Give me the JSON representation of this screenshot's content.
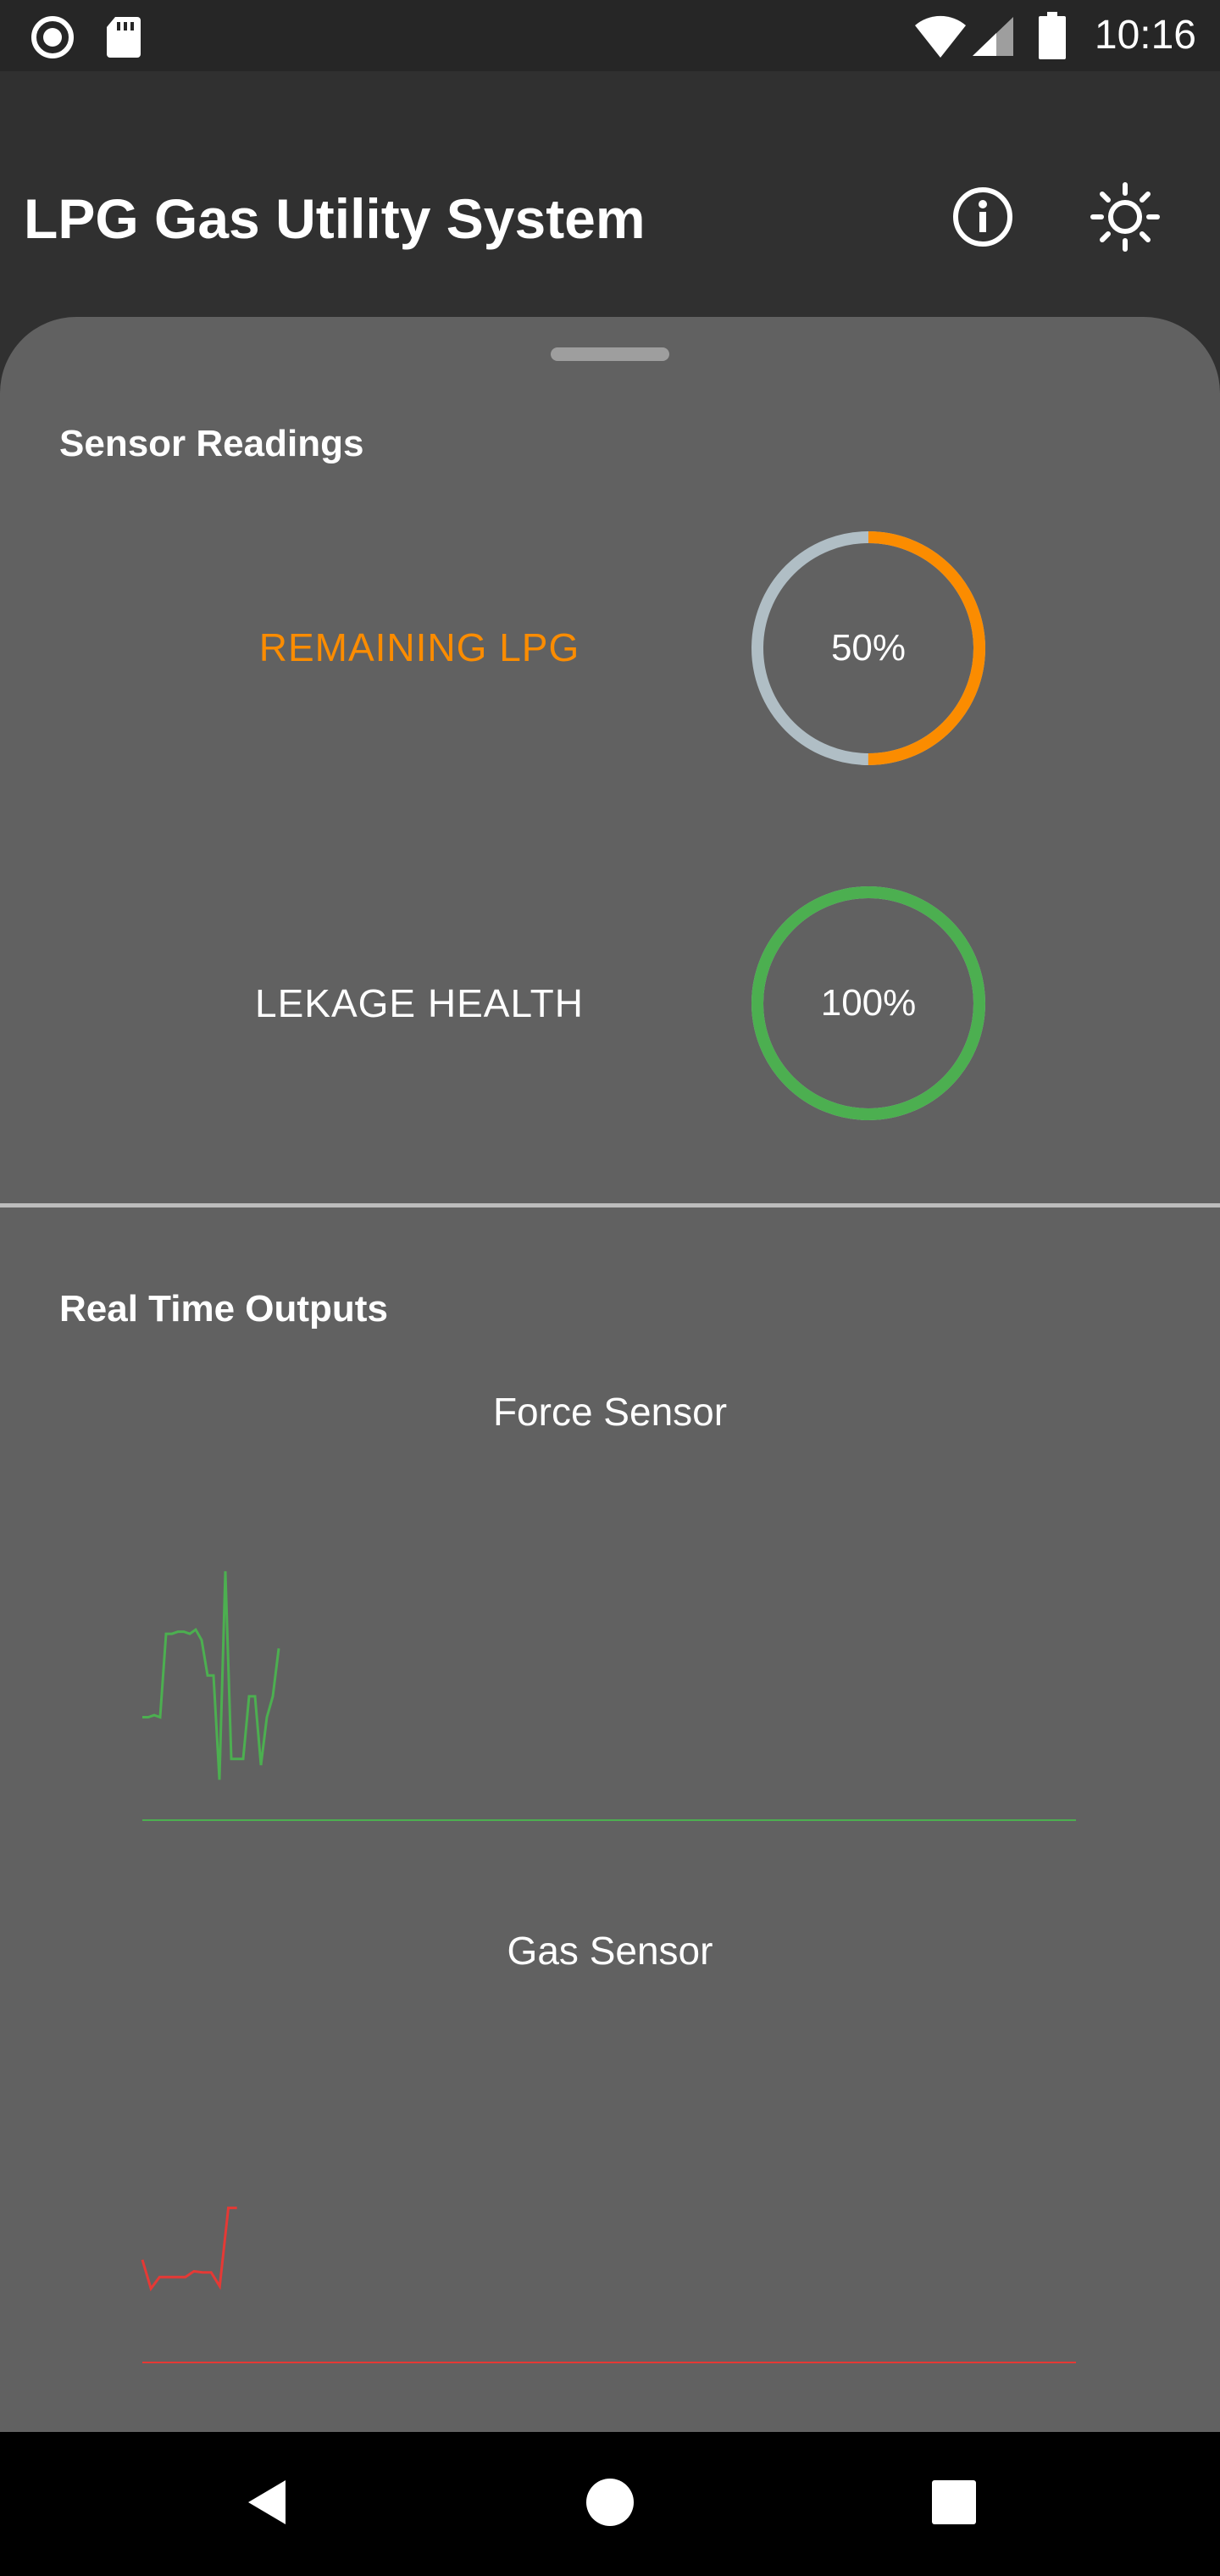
{
  "status_bar": {
    "time": "10:16",
    "icons": [
      "record-icon",
      "sd-card-icon",
      "wifi-icon",
      "signal-icon",
      "battery-icon"
    ]
  },
  "app_bar": {
    "title": "LPG Gas Utility System",
    "actions": [
      "info-icon",
      "brightness-icon"
    ]
  },
  "sensor_readings": {
    "title": "Sensor Readings",
    "items": [
      {
        "label": "REMAINING LPG",
        "value_text": "50%",
        "value": 0.5,
        "color": "#fb8c00",
        "track_color": "#b0bec5"
      },
      {
        "label": "LEKAGE HEALTH",
        "value_text": "100%",
        "value": 1.0,
        "color": "#4caf50",
        "track_color": "#b0bec5"
      }
    ]
  },
  "real_time": {
    "title": "Real Time Outputs",
    "charts": [
      {
        "title": "Force Sensor",
        "chart_data": {
          "type": "line",
          "color": "#4caf50",
          "values": [
            0.25,
            0.25,
            0.26,
            0.25,
            0.65,
            0.65,
            0.66,
            0.66,
            0.65,
            0.67,
            0.62,
            0.45,
            0.45,
            -0.05,
            0.95,
            0.05,
            0.05,
            0.05,
            0.35,
            0.35,
            0.02,
            0.25,
            0.35,
            0.58
          ]
        }
      },
      {
        "title": "Gas Sensor",
        "chart_data": {
          "type": "line",
          "color": "#e53935",
          "values": [
            0.45,
            0.2,
            0.3,
            0.3,
            0.3,
            0.3,
            0.35,
            0.34,
            0.34,
            0.22,
            0.9,
            0.9
          ]
        }
      }
    ]
  },
  "nav_bar": {
    "buttons": [
      "back-icon",
      "home-icon",
      "recents-icon"
    ]
  },
  "colors": {
    "sheet": "#616161",
    "background": "#303030",
    "accent_orange": "#fb8c00",
    "accent_green": "#4caf50",
    "accent_red": "#e53935"
  }
}
